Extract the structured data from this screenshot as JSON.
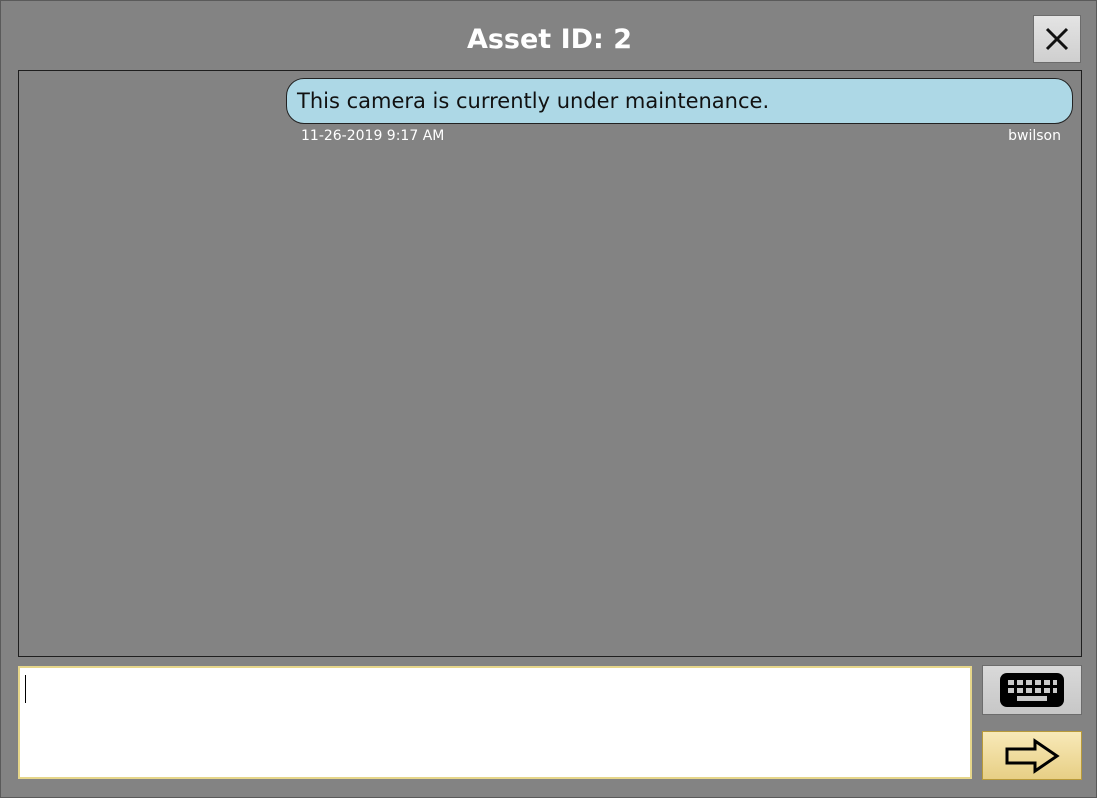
{
  "dialog": {
    "title": "Asset ID: 2"
  },
  "messages": [
    {
      "text": "This camera is currently under maintenance.",
      "timestamp": "11-26-2019 9:17 AM",
      "author": "bwilson"
    }
  ],
  "composer": {
    "value": "",
    "placeholder": ""
  },
  "icons": {
    "close": "close-icon",
    "keyboard": "keyboard-icon",
    "send": "arrow-right-icon"
  },
  "colors": {
    "background": "#838383",
    "bubble": "#add8e6",
    "send_button": "#f2dd9c",
    "input_border": "#e6d68a"
  }
}
